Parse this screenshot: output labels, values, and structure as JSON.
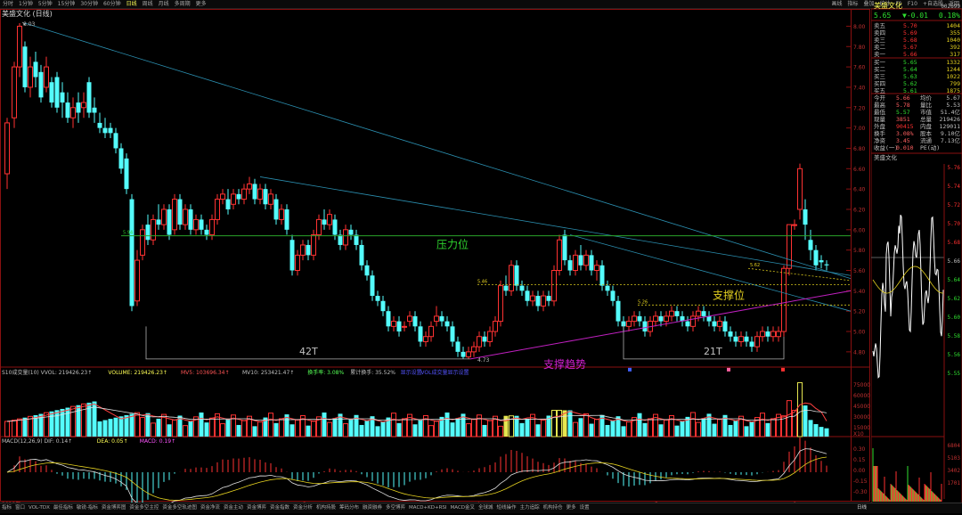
{
  "topbar": {
    "periods": [
      "分时",
      "1分钟",
      "5分钟",
      "15分钟",
      "30分钟",
      "60分钟",
      "日线",
      "周线",
      "月线",
      "多周期",
      "更多"
    ],
    "active_period": "日线",
    "right_tools": [
      "画线",
      "指标",
      "叠加",
      "统计",
      "F1",
      "F10",
      "+自选股",
      "返回"
    ]
  },
  "chart": {
    "title": "美盛文化 (日线)",
    "high_label": "8.03",
    "price_ticks": [
      "8.00",
      "7.80",
      "7.60",
      "7.40",
      "7.20",
      "7.00",
      "6.80",
      "6.60",
      "6.40",
      "6.20",
      "6.00",
      "5.80",
      "5.60",
      "5.40",
      "5.20",
      "5.00",
      "4.80"
    ],
    "annotations": {
      "resistance": "压力位",
      "support": "支撑位",
      "support_trend": "支撑趋势",
      "period1": "42T",
      "period2": "21T",
      "low_label": "4.73",
      "level_594": "5.94",
      "level_546": "5.46",
      "level_526": "5.26",
      "level_562": "5.62"
    },
    "colors": {
      "up": "#ff3232",
      "down": "#54fcfc",
      "resist": "#2aa52a",
      "support": "#d4c41c",
      "trend": "#c020c0",
      "fan": "#2b8fb0"
    }
  },
  "volume": {
    "header": [
      {
        "text": "S10成交量(10) VVOL: 219426.23↑",
        "color": "#c0c0c0"
      },
      {
        "text": "VOLUME: 219426.23↑",
        "color": "#ffff55"
      },
      {
        "text": "MV5: 103696.34↑",
        "color": "#ff5555"
      },
      {
        "text": "MV10: 253421.47↑",
        "color": "#c0c0c0"
      },
      {
        "text": "换手率: 3.08%",
        "color": "#55ff55"
      },
      {
        "text": "累计换手: 35.52%",
        "color": "#c0c0c0"
      },
      {
        "text": "显示设置",
        "color": "#5555ff"
      },
      {
        "text": "VOL成交量显示设置",
        "color": "#5555ff"
      }
    ],
    "ticks": [
      "75000",
      "60000",
      "45000",
      "30000",
      "15000",
      "X10"
    ]
  },
  "macd": {
    "header": [
      {
        "text": "MACD(12,26,9) DIF: 0.14↑",
        "color": "#c0c0c0"
      },
      {
        "text": "DEA: 0.05↑",
        "color": "#ffff55"
      },
      {
        "text": "MACD: 0.19↑",
        "color": "#ff55ff"
      }
    ],
    "ticks": [
      "0.30",
      "0.15",
      "0.00",
      "-0.15",
      "-0.30"
    ]
  },
  "x_axis": [
    "2019年",
    "2",
    "3",
    "4",
    "5",
    "6"
  ],
  "quote": {
    "name": "美盛文化",
    "code": "002699",
    "price": "5.65",
    "change": "▼-0.01",
    "pct": "0.18%",
    "sells": [
      {
        "label": "卖五",
        "price": "5.70",
        "vol": "1404"
      },
      {
        "label": "卖四",
        "price": "5.69",
        "vol": "355"
      },
      {
        "label": "卖三",
        "price": "5.68",
        "vol": "1040"
      },
      {
        "label": "卖二",
        "price": "5.67",
        "vol": "392"
      },
      {
        "label": "卖一",
        "price": "5.66",
        "vol": "317"
      }
    ],
    "buys": [
      {
        "label": "买一",
        "price": "5.65",
        "vol": "1332"
      },
      {
        "label": "买二",
        "price": "5.64",
        "vol": "1244"
      },
      {
        "label": "买三",
        "price": "5.63",
        "vol": "1022"
      },
      {
        "label": "买四",
        "price": "5.62",
        "vol": "799"
      },
      {
        "label": "买五",
        "price": "5.61",
        "vol": "1875"
      }
    ],
    "stats": [
      {
        "l1": "今开",
        "v1": "5.66",
        "l2": "均价",
        "v2": "5.67"
      },
      {
        "l1": "最高",
        "v1": "5.78",
        "l2": "量比",
        "v2": "5.53"
      },
      {
        "l1": "最低",
        "v1": "5.57",
        "l2": "市值",
        "v2": "51.4亿"
      },
      {
        "l1": "现量",
        "v1": "3851",
        "l2": "总量",
        "v2": "219426"
      },
      {
        "l1": "外盘",
        "v1": "90415",
        "l2": "内盘",
        "v2": "129011"
      },
      {
        "l1": "换手",
        "v1": "3.08%",
        "l2": "股本",
        "v2": "9.10亿"
      },
      {
        "l1": "净资",
        "v1": "3.45",
        "l2": "流通",
        "v2": "7.13亿"
      },
      {
        "l1": "收益(一)",
        "v1": "0.010",
        "l2": "PE(动)",
        "v2": ""
      }
    ],
    "mini_title": "美盛文化",
    "mini_price_ticks": [
      "5.76",
      "5.74",
      "5.72",
      "5.70",
      "5.68",
      "5.66",
      "5.64",
      "5.62",
      "5.60",
      "5.58",
      "5.56",
      "5.55"
    ],
    "mini_pct_ticks": [
      "1.84%",
      "1.47%",
      "1.10%",
      "0.73%",
      "0.37%",
      "0.00%",
      "0.37%",
      "0.73%",
      "1.10%",
      "1.47%",
      "1.84%"
    ],
    "mini_vol_ticks": [
      "6804",
      "5103",
      "3402",
      "1701"
    ]
  },
  "bottombar": {
    "tabs": [
      "指标",
      "窗口",
      "VOL-TDX",
      "最佳指标",
      "敏锐-指标",
      "资金博弈图",
      "资金多空主控",
      "资金多空轨迹图",
      "资金净流",
      "资金主动",
      "资金博弈",
      "资金指数",
      "资金分析",
      "机构持股",
      "筹码分布",
      "融资融券",
      "多空博弈",
      "MACD+KD+RSI",
      "MACD金叉",
      "全球城",
      "短线操作",
      "主力追踪",
      "机构持仓",
      "更多",
      "设置"
    ],
    "right": "日线"
  }
}
